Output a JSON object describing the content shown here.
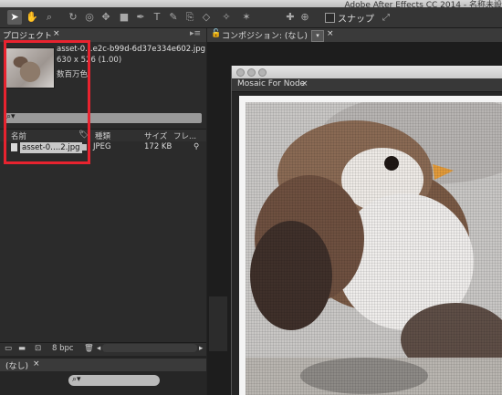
{
  "app": {
    "title": "Adobe After Effects CC 2014 - 名称未設"
  },
  "toolbar": {
    "snap_label": "スナップ",
    "tools": [
      "arrow-tool-icon",
      "hand-tool-icon",
      "zoom-tool-icon",
      "rotate-tool-icon",
      "camera-tool-icon",
      "pan-tool-icon",
      "mask-rect-tool-icon",
      "pen-tool-icon",
      "text-tool-icon",
      "brush-tool-icon",
      "clone-tool-icon",
      "eraser-tool-icon",
      "roto-tool-icon",
      "puppet-tool-icon"
    ]
  },
  "project_panel": {
    "tab_label": "プロジェクト",
    "selected_file": {
      "name": "asset-0…e2c-b99d-6d37e334e602.jpg ▼",
      "dimensions": "630 x 526 (1.00)",
      "color": "数百万色"
    },
    "columns": {
      "name": "名前",
      "type": "種類",
      "size": "サイズ",
      "frame": "フレ..."
    },
    "rows": [
      {
        "name": "asset-0….2.jpg",
        "type": "JPEG",
        "size": "172 KB"
      }
    ],
    "bit_depth": "8 bpc"
  },
  "bottom_panel": {
    "tab_label": "(なし)"
  },
  "composition": {
    "tab_label": "コンポジション: (なし)",
    "viewer_tab_label": "Mosaic For Node"
  },
  "colors": {
    "highlight": "#e8232f"
  }
}
